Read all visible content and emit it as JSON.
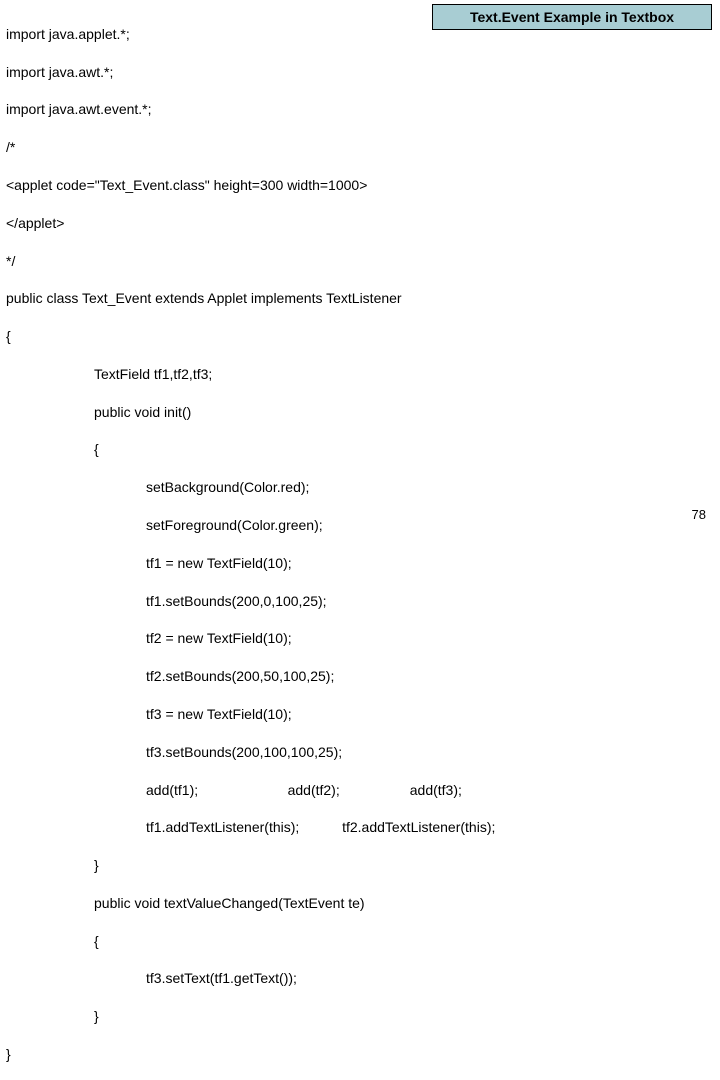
{
  "title": "Text.Event Example in Textbox",
  "pageNumber": "78",
  "code": {
    "l1": "import java.applet.*;",
    "l2": "import java.awt.*;",
    "l3": "import java.awt.event.*;",
    "l4": "/*",
    "l5": "<applet code=\"Text_Event.class\" height=300 width=1000>",
    "l6": "</applet>",
    "l7": "*/",
    "l8": "public class Text_Event extends Applet implements TextListener",
    "l9": "{",
    "l10": "TextField tf1,tf2,tf3;",
    "l11": "public void init()",
    "l12": "{",
    "l13": "setBackground(Color.red);",
    "l14": "setForeground(Color.green);",
    "l15": "tf1 = new TextField(10);",
    "l16": "tf1.setBounds(200,0,100,25);",
    "l17": "tf2 = new TextField(10);",
    "l18": "tf2.setBounds(200,50,100,25);",
    "l19": "tf3 = new TextField(10);",
    "l20": "tf3.setBounds(200,100,100,25);",
    "l21": "add(tf1);                       add(tf2);                  add(tf3);",
    "l22": "tf1.addTextListener(this);           tf2.addTextListener(this);",
    "l23": "}",
    "l24": "public void textValueChanged(TextEvent te)",
    "l25": "{",
    "l26": "tf3.setText(tf1.getText());",
    "l27": "}",
    "l28": "}"
  }
}
